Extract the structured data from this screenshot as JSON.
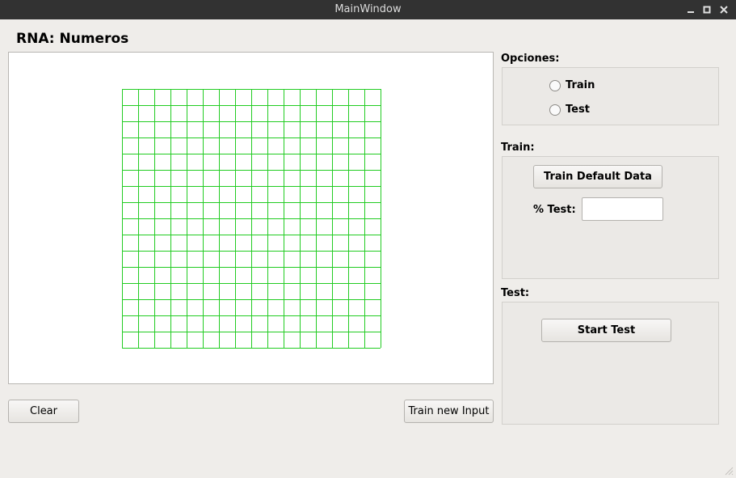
{
  "window": {
    "title": "MainWindow"
  },
  "heading": "RNA: Numeros",
  "drawing_grid": {
    "rows": 16,
    "cols": 16,
    "line_color": "#22cc22"
  },
  "buttons": {
    "clear": "Clear",
    "train_new_input": "Train new Input",
    "train_default": "Train Default Data",
    "start_test": "Start Test"
  },
  "options": {
    "title": "Opciones:",
    "train_label": "Train",
    "test_label": "Test"
  },
  "train_section": {
    "title": "Train:",
    "test_percent_label": "% Test:",
    "test_percent_value": ""
  },
  "test_section": {
    "title": "Test:"
  }
}
